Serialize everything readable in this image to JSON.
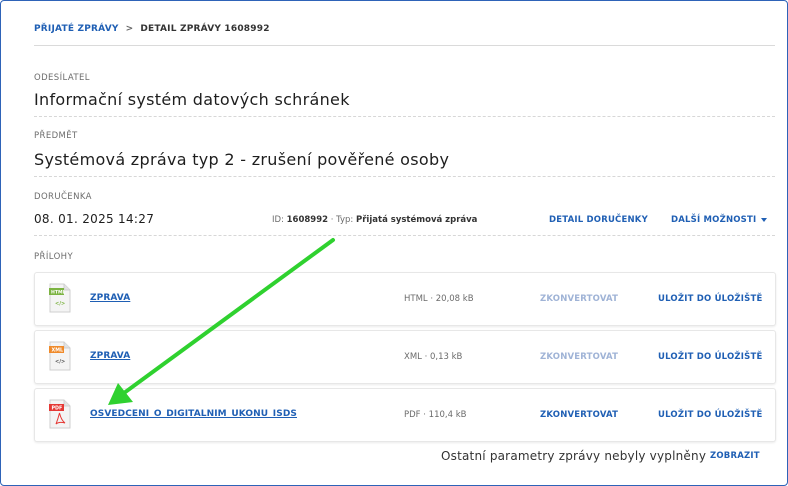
{
  "breadcrumb": {
    "parent": "PŘIJATÉ ZPRÁVY",
    "separator": ">",
    "current": "DETAIL ZPRÁVY 1608992"
  },
  "sender": {
    "label": "ODESÍLATEL",
    "value": "Informační systém datových schránek"
  },
  "subject": {
    "label": "PŘEDMĚT",
    "value": "Systémová zpráva typ 2 - zrušení pověřené osoby"
  },
  "receipt": {
    "label": "DORUČENKA",
    "date": "08. 01. 2025 14:27",
    "id_label": "ID:",
    "id_value": "1608992",
    "type_label": "Typ:",
    "type_value": "Přijatá systémová zpráva",
    "separator": "·",
    "detail_button": "DETAIL DORUČENKY",
    "more_button": "DALŠÍ MOŽNOSTI"
  },
  "attachments": {
    "label": "PŘÍLOHY",
    "items": [
      {
        "icon": "html-file-icon",
        "icon_tag": "HTML",
        "icon_color": "#7cb342",
        "name": "ZPRAVA",
        "meta": "HTML · 20,08 kB",
        "convert": "ZKONVERTOVAT",
        "convert_enabled": false,
        "save": "ULOŽIT DO ÚLOŽIŠTĚ"
      },
      {
        "icon": "xml-file-icon",
        "icon_tag": "XML",
        "icon_color": "#ef8a2a",
        "name": "ZPRAVA",
        "meta": "XML · 0,13 kB",
        "convert": "ZKONVERTOVAT",
        "convert_enabled": false,
        "save": "ULOŽIT DO ÚLOŽIŠTĚ"
      },
      {
        "icon": "pdf-file-icon",
        "icon_tag": "PDF",
        "icon_color": "#e53935",
        "name": "OSVEDCENI_O_DIGITALNIM_UKONU_ISDS",
        "meta": "PDF · 110,4 kB",
        "convert": "ZKONVERTOVAT",
        "convert_enabled": true,
        "save": "ULOŽIT DO ÚLOŽIŠTĚ"
      }
    ]
  },
  "footer": {
    "text": "Ostatní parametry zprávy nebyly vyplněny",
    "show_button": "ZOBRAZIT"
  },
  "annotation": {
    "arrow_color": "#2fd12f"
  },
  "colors": {
    "accent": "#1f5fb4",
    "disabled": "#9fb3d6",
    "frame": "#2e63b8"
  }
}
